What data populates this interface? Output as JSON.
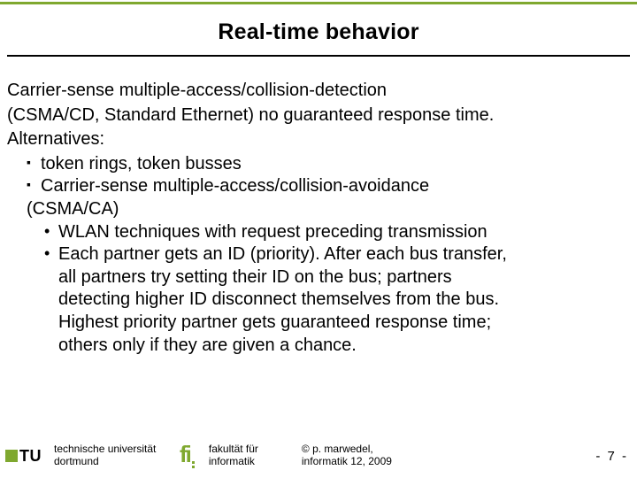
{
  "slide": {
    "title": "Real-time behavior",
    "body": {
      "p1": "Carrier-sense multiple-access/collision-detection",
      "p2": "(CSMA/CD, Standard Ethernet) no guaranteed response time.",
      "p3": "Alternatives:",
      "b1": "token rings, token busses",
      "b2": "Carrier-sense multiple-access/collision-avoidance",
      "b2c": "(CSMA/CA)",
      "d1": "WLAN techniques with request preceding transmission",
      "d2": "Each partner gets an ID (priority). After each bus transfer,",
      "d2c1": "all partners try setting their ID on the bus; partners",
      "d2c2": "detecting higher ID disconnect themselves from the bus.",
      "d2c3": "Highest priority partner gets guaranteed response time;",
      "d2c4": "others only if they are given a chance."
    }
  },
  "footer": {
    "tu": "TU",
    "uni_line1": "technische universität",
    "uni_line2": "dortmund",
    "fak_line1": "fakultät für",
    "fak_line2": "informatik",
    "copy_line1": "©  p. marwedel,",
    "copy_line2": "informatik 12,  2009",
    "page": "-  7 -"
  }
}
